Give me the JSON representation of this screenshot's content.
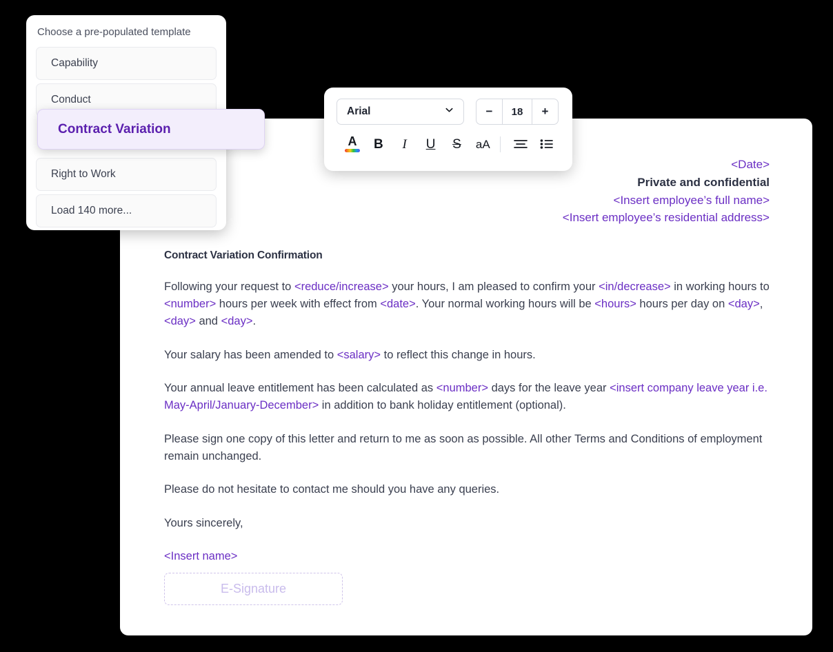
{
  "template_panel": {
    "title": "Choose a pre-populated template",
    "items": [
      {
        "label": "Capability"
      },
      {
        "label": "Conduct"
      },
      {
        "label": "Right to Work"
      },
      {
        "label": "Load 140 more..."
      }
    ],
    "selected": {
      "label": "Contract Variation",
      "bg_color": "#f3eefc",
      "text_color": "#5b1fae"
    }
  },
  "toolbar": {
    "font_family_value": "Arial",
    "chevron_icon": "chevron-down-icon",
    "size_decrease_label": "−",
    "size_value": "18",
    "size_increase_label": "+",
    "icons": [
      {
        "name": "text-color-icon",
        "glyph": "A"
      },
      {
        "name": "bold-icon",
        "glyph": "B"
      },
      {
        "name": "italic-icon",
        "glyph": "I"
      },
      {
        "name": "underline-icon",
        "glyph": "U"
      },
      {
        "name": "strikethrough-icon",
        "glyph": "S"
      },
      {
        "name": "text-case-icon",
        "glyph": "aA"
      },
      {
        "name": "align-center-icon",
        "glyph": ""
      },
      {
        "name": "bulleted-list-icon",
        "glyph": ""
      }
    ]
  },
  "document": {
    "header": {
      "date": "<Date>",
      "confidential": "Private and confidential",
      "employee_name": "<Insert employee’s full name>",
      "employee_address": "<Insert employee’s residential address>"
    },
    "title": "Contract Variation Confirmation",
    "paragraph1": {
      "t1": "Following your request to ",
      "p1": "<reduce/increase>",
      "t2": " your hours, I am pleased to confirm your ",
      "p2": "<in/decrease>",
      "t3": " in working hours to ",
      "p3": "<number>",
      "t4": " hours per week with effect from ",
      "p4": "<date>",
      "t5": ". Your normal working hours will be ",
      "p5": "<hours>",
      "t6": " hours per day on ",
      "p6": "<day>",
      "t7": ", ",
      "p7": "<day>",
      "t8": " and ",
      "p8": "<day>",
      "t9": "."
    },
    "paragraph2": {
      "t1": "Your salary has been amended to ",
      "p1": "<salary>",
      "t2": " to reflect this change in hours."
    },
    "paragraph3": {
      "t1": "Your annual leave entitlement has been calculated as ",
      "p1": "<number>",
      "t2": " days for the leave year ",
      "p2": "<insert company leave year i.e. May-April/January-December>",
      "t3": " in addition to bank holiday entitlement (optional)."
    },
    "paragraph4": "Please sign one copy of this letter and return to me as soon as possible. All other Terms and Conditions of employment remain unchanged.",
    "paragraph5": "Please do not hesitate to contact me should you have any queries.",
    "signoff": "Yours sincerely,",
    "signature_name": "<Insert name>",
    "esignature_label": "E-Signature",
    "placeholder_color": "#6b2fc4"
  }
}
